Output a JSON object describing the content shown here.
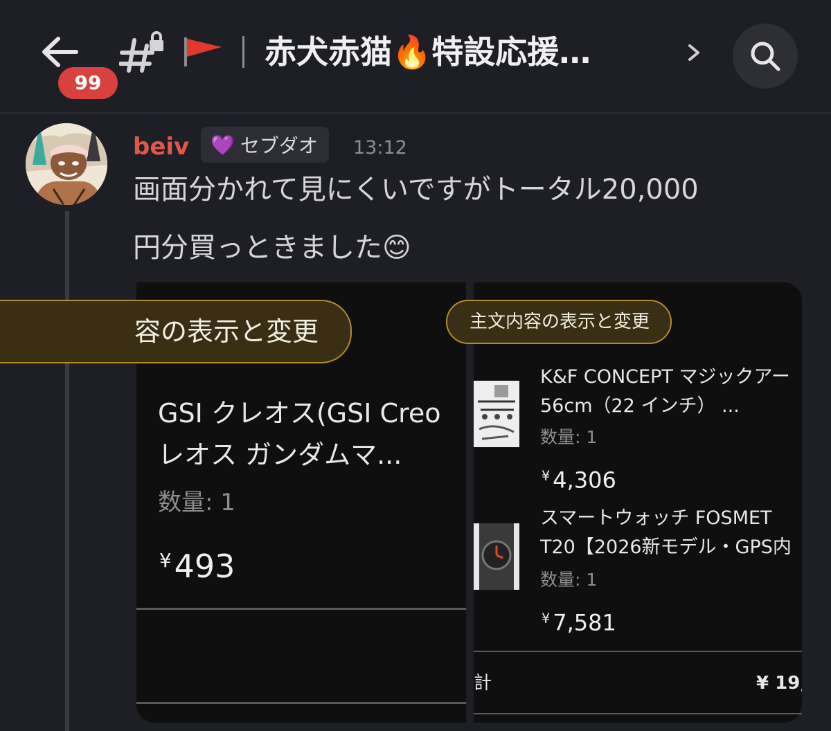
{
  "header": {
    "unread_count": "99",
    "channel_title": "赤犬赤猫🔥特設応援…",
    "icons": [
      "back-arrow-icon",
      "locked-channel-icon",
      "red-flag-icon",
      "chevron-right-icon",
      "search-icon"
    ]
  },
  "message": {
    "author": "beiv",
    "role_heart": "💜",
    "role_name": "セブダオ",
    "time": "13:12",
    "lines": [
      "画面分かれて見にくいですがトータル20,000",
      "円分買っときました😊"
    ]
  },
  "screenshot_left": {
    "order_button": "容の表示と変更",
    "product_name_line1": "GSI クレオス(GSI Creo",
    "product_name_line2": "レオス ガンダムマ...",
    "quantity": "数量: 1",
    "currency": "¥",
    "price": "493"
  },
  "screenshot_right": {
    "order_button": "主文内容の表示と変更",
    "items": [
      {
        "name_line1": "K&F CONCEPT マジックアー",
        "name_line2": "56cm（22 インチ） ...",
        "quantity": "数量: 1",
        "currency": "¥",
        "price": "4,306"
      },
      {
        "name_line1": "スマートウォッチ FOSMET",
        "name_line2": "T20【2026新モデル・GPS内",
        "quantity": "数量: 1",
        "currency": "¥",
        "price": "7,581"
      }
    ],
    "total_label": "計",
    "total_value": "¥ 19,"
  },
  "colors": {
    "background": "#1e1f24",
    "username": "#e2574c",
    "badge": "#d9413e",
    "pill_border": "#b48a2c"
  }
}
